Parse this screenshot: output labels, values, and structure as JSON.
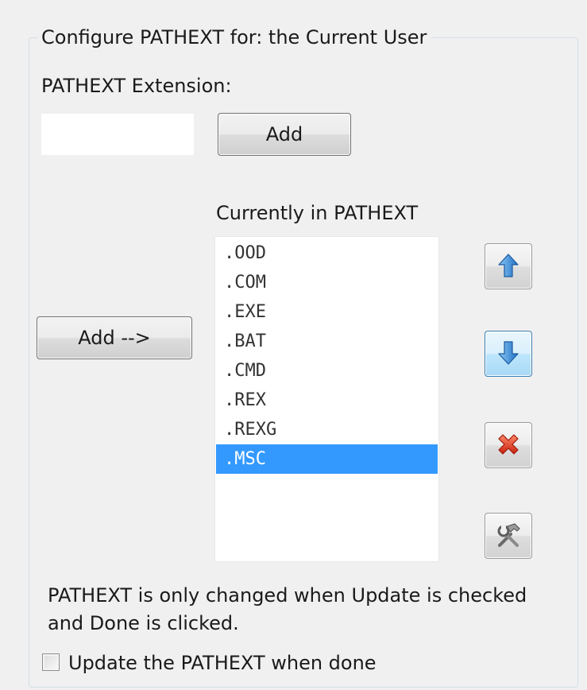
{
  "group": {
    "title": "Configure PATHEXT for:  the Current User"
  },
  "extension": {
    "label": "PATHEXT Extension:",
    "value": "",
    "add_label": "Add"
  },
  "list": {
    "header": "Currently in PATHEXT",
    "add_arrow_label": "Add -->",
    "items": [
      ".OOD",
      ".COM",
      ".EXE",
      ".BAT",
      ".CMD",
      ".REX",
      ".REXG",
      ".MSC"
    ],
    "selected": ".MSC"
  },
  "actions": {
    "move_up_icon": "arrow-up-icon",
    "move_down_icon": "arrow-down-icon",
    "remove_icon": "delete-x-icon",
    "tools_icon": "hammer-wrench-icon"
  },
  "note": {
    "line1": "PATHEXT is only changed when Update is checked",
    "line2": "and Done is clicked."
  },
  "update": {
    "label": "Update the PATHEXT when done",
    "checked": false
  },
  "colors": {
    "selection": "#3399ff",
    "arrow_blue": "#2f86d8",
    "delete_red": "#e0331e"
  }
}
